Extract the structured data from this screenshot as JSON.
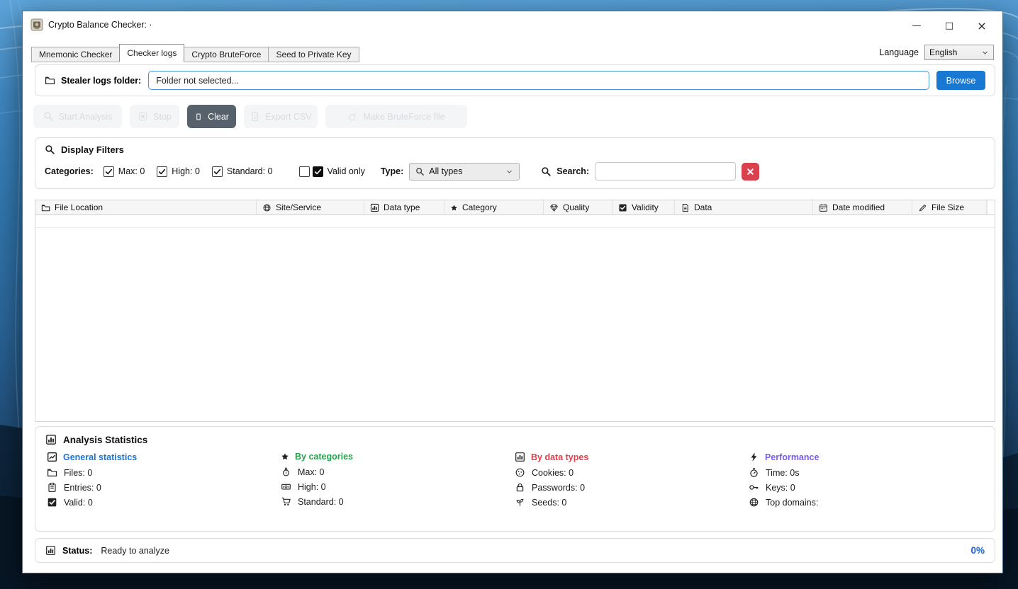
{
  "window": {
    "title": "Crypto Balance Checker: ·",
    "controls": {
      "minimize": "—",
      "maximize": "□",
      "close": "×"
    }
  },
  "tabs": [
    {
      "label": "Mnemonic Checker",
      "active": false
    },
    {
      "label": "Checker logs",
      "active": true
    },
    {
      "label": "Crypto BruteForce",
      "active": false
    },
    {
      "label": "Seed to Private Key",
      "active": false
    }
  ],
  "language": {
    "label": "Language",
    "value": "English"
  },
  "folder": {
    "label": "Stealer logs folder:",
    "value": "Folder not selected...",
    "browse_label": "Browse"
  },
  "actions": {
    "start": "Start Analysis",
    "stop": "Stop",
    "clear": "Clear",
    "export": "Export CSV",
    "bruteforce": "Make BruteForce file"
  },
  "filters": {
    "title": "Display Filters",
    "categories_label": "Categories:",
    "max": {
      "label": "Max: 0",
      "checked": true
    },
    "high": {
      "label": "High: 0",
      "checked": true
    },
    "standard": {
      "label": "Standard: 0",
      "checked": true
    },
    "valid_only": {
      "label": "Valid only",
      "checked": true,
      "extra_checkbox_checked": false
    },
    "type_label": "Type:",
    "type_value": "All types",
    "search_label": "Search:",
    "search_value": ""
  },
  "table": {
    "columns": [
      {
        "label": "File Location"
      },
      {
        "label": "Site/Service"
      },
      {
        "label": "Data type"
      },
      {
        "label": "Category"
      },
      {
        "label": "Quality"
      },
      {
        "label": "Validity"
      },
      {
        "label": "Data"
      },
      {
        "label": "Date modified"
      },
      {
        "label": "File Size"
      }
    ],
    "rows": []
  },
  "stats": {
    "title": "Analysis Statistics",
    "groups": [
      {
        "title": "General statistics",
        "color": "#1a73d9",
        "items": [
          {
            "label": "Files: 0"
          },
          {
            "label": "Entries: 0"
          },
          {
            "label": "Valid: 0"
          }
        ]
      },
      {
        "title": "By categories",
        "color": "#23a44a",
        "items": [
          {
            "label": "Max: 0"
          },
          {
            "label": "High: 0"
          },
          {
            "label": "Standard: 0"
          }
        ]
      },
      {
        "title": "By data types",
        "color": "#e0404e",
        "items": [
          {
            "label": "Cookies: 0"
          },
          {
            "label": "Passwords: 0"
          },
          {
            "label": "Seeds: 0"
          }
        ]
      },
      {
        "title": "Performance",
        "color": "#7b5cf0",
        "items": [
          {
            "label": "Time: 0s"
          },
          {
            "label": "Keys: 0"
          },
          {
            "label": "Top domains:"
          }
        ]
      }
    ]
  },
  "status": {
    "label": "Status:",
    "value": "Ready to analyze",
    "progress": "0%"
  },
  "colors": {
    "accent_blue": "#1878d2",
    "danger_red": "#d8414d",
    "success_green": "#23a44a",
    "purple": "#7b5cf0",
    "clear_button": "#57616b"
  }
}
